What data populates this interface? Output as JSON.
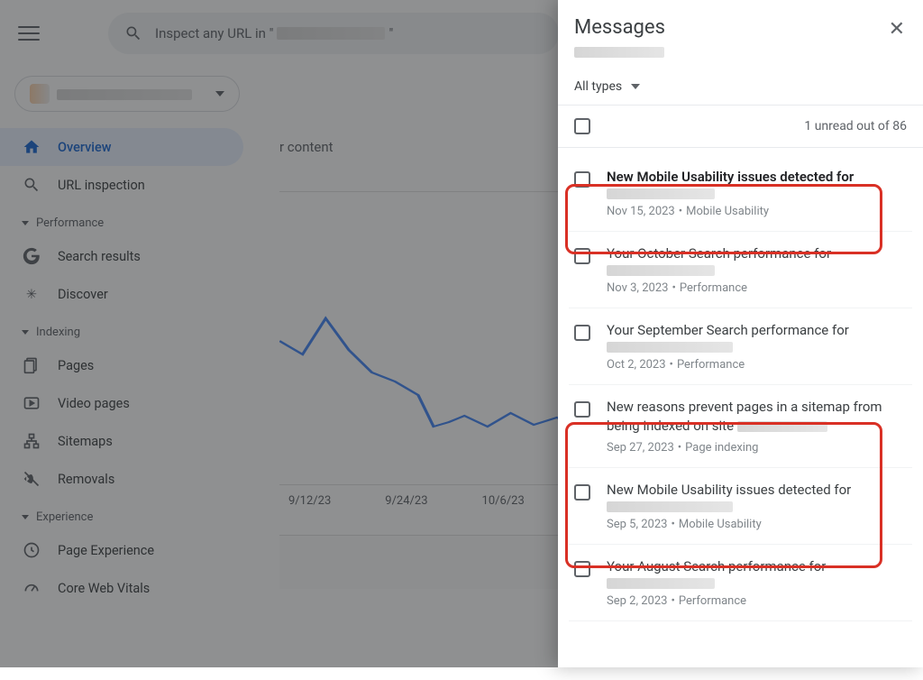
{
  "search": {
    "placeholder_prefix": "Inspect any URL in \"",
    "placeholder_suffix": "\""
  },
  "sidebar": {
    "items": {
      "overview": "Overview",
      "url_inspection": "URL inspection",
      "search_results": "Search results",
      "discover": "Discover",
      "pages": "Pages",
      "video_pages": "Video pages",
      "sitemaps": "Sitemaps",
      "removals": "Removals",
      "page_experience": "Page Experience",
      "core_web_vitals": "Core Web Vitals"
    },
    "sections": {
      "performance": "Performance",
      "indexing": "Indexing",
      "experience": "Experience"
    }
  },
  "main": {
    "content_fragment": "r content"
  },
  "chart": {
    "xlabels": [
      "9/12/23",
      "9/24/23",
      "10/6/23"
    ]
  },
  "panel": {
    "title": "Messages",
    "filter_label": "All types",
    "unread_text": "1 unread out of 86"
  },
  "messages": [
    {
      "title": "New Mobile Usability issues detected for",
      "date": "Nov 15, 2023",
      "category": "Mobile Usability",
      "unread": true
    },
    {
      "title": "Your October Search performance for",
      "date": "Nov 3, 2023",
      "category": "Performance",
      "unread": false
    },
    {
      "title": "Your September Search performance for",
      "date": "Oct 2, 2023",
      "category": "Performance",
      "unread": false
    },
    {
      "title": "New reasons prevent pages in a sitemap from being indexed on site",
      "date": "Sep 27, 2023",
      "category": "Page indexing",
      "unread": false
    },
    {
      "title": "New Mobile Usability issues detected for",
      "date": "Sep 5, 2023",
      "category": "Mobile Usability",
      "unread": false
    },
    {
      "title": "Your August Search performance for",
      "date": "Sep 2, 2023",
      "category": "Performance",
      "unread": false
    }
  ]
}
